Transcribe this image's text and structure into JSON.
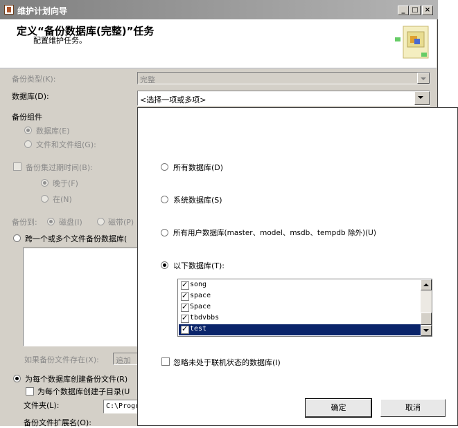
{
  "window": {
    "title": "维护计划向导",
    "minimize_label": "_",
    "maximize_label": "□",
    "close_label": "×"
  },
  "header": {
    "title": "定义“备份数据库(完整)”任务",
    "subtitle": "配置维护任务。"
  },
  "form": {
    "backup_type_label": "备份类型(K):",
    "backup_type_value": "完整",
    "database_label": "数据库(D):",
    "database_value": "<选择一项或多项>",
    "backup_component_label": "备份组件",
    "component_database": "数据库(E)",
    "component_files": "文件和文件组(G):",
    "expire_label": "备份集过期时间(B):",
    "expire_after": "晚于(F)",
    "expire_on": "在(N)",
    "backup_to_label": "备份到:",
    "backup_to_disk": "磁盘(I)",
    "backup_to_tape": "磁带(P)",
    "span_files_label": "跨一个或多个文件备份数据库(",
    "if_exists_label": "如果备份文件存在(X):",
    "if_exists_value": "追加",
    "per_db_file_label": "为每个数据库创建备份文件(R)",
    "per_db_subdir_label": "为每个数据库创建子目录(U",
    "folder_label": "文件夹(L):",
    "folder_value": "C:\\Progr",
    "ext_label": "备份文件扩展名(O):"
  },
  "popup": {
    "option_all": "所有数据库(D)",
    "option_system": "系统数据库(S)",
    "option_user": "所有用户数据库(master、model、msdb、tempdb 除外)(U)",
    "option_these": "以下数据库(T):",
    "databases": [
      {
        "name": "song",
        "checked": true,
        "selected": false
      },
      {
        "name": "space",
        "checked": true,
        "selected": false
      },
      {
        "name": "Space",
        "checked": true,
        "selected": false
      },
      {
        "name": "tbdvbbs",
        "checked": true,
        "selected": false
      },
      {
        "name": "test",
        "checked": true,
        "selected": true
      }
    ],
    "ignore_offline_label": "忽略未处于联机状态的数据库(I)",
    "ok_label": "确定",
    "cancel_label": "取消"
  }
}
